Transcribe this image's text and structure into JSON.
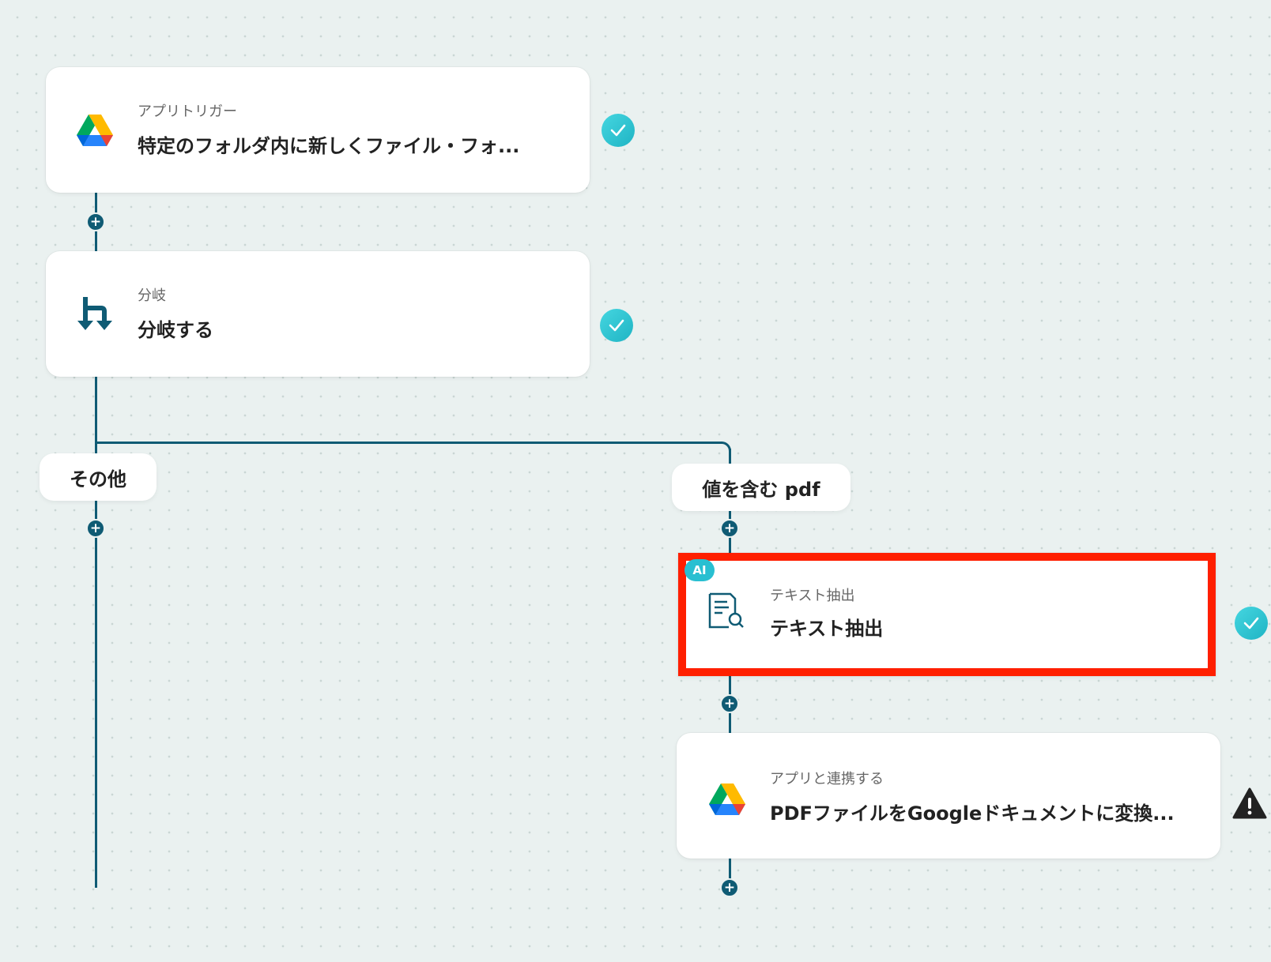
{
  "flow": {
    "trigger": {
      "type_label": "アプリトリガー",
      "title": "特定のフォルダ内に新しくファイル・フォ...",
      "icon": "google-drive-icon",
      "status": "complete"
    },
    "branch": {
      "type_label": "分岐",
      "title": "分岐する",
      "icon": "branch-icon",
      "status": "complete"
    },
    "branches": {
      "other_label": "その他",
      "condition_label": "値を含む pdf"
    },
    "text_extract": {
      "badge": "AI",
      "type_label": "テキスト抽出",
      "title": "テキスト抽出",
      "icon": "document-search-icon",
      "status": "complete"
    },
    "convert": {
      "type_label": "アプリと連携する",
      "title": "PDFファイルをGoogleドキュメントに変換...",
      "icon": "google-drive-icon",
      "status": "warning"
    }
  },
  "colors": {
    "line": "#0f5b74",
    "check": "#29bfd1",
    "highlight": "#ff1f00"
  }
}
